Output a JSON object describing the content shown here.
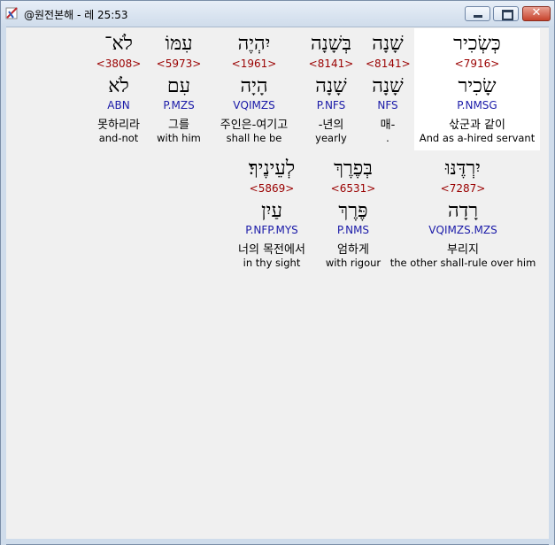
{
  "window": {
    "title": "@원전본해 - 레 25:53",
    "close_glyph": "✕"
  },
  "verse_rows": [
    [
      {
        "surface": "כְּשְׂכִיר",
        "strong": "<7916>",
        "lemma": "שָׂכִיר",
        "morph": "P.NMSG",
        "korean": "삯군과 같이",
        "english": "And as a-hired servant",
        "highlighted": true
      },
      {
        "surface": "שָׁנָה",
        "strong": "<8141>",
        "lemma": "שָׁנָה",
        "morph": "NFS",
        "korean": "매-",
        "english": "."
      },
      {
        "surface": "בְּשָׁנָה",
        "strong": "<8141>",
        "lemma": "שָׁנָה",
        "morph": "P.NFS",
        "korean": "-년의",
        "english": "yearly"
      },
      {
        "surface": "יִהְיֶה",
        "strong": "<1961>",
        "lemma": "הָיָה",
        "morph": "VQIMZS",
        "korean": "주인은-여기고",
        "english": "shall he be"
      },
      {
        "surface": "עִמּוֹ",
        "strong": "<5973>",
        "lemma": "עִם",
        "morph": "P.MZS",
        "korean": "그를",
        "english": "with him"
      },
      {
        "surface": "לֹא־",
        "strong": "<3808>",
        "lemma": "לֹא",
        "morph": "ABN",
        "korean": "못하리라",
        "english": "and-not"
      }
    ],
    [
      {
        "surface": "יִרְדֶּנּוּ",
        "strong": "<7287>",
        "lemma": "רָדָה",
        "morph": "VQIMZS.MZS",
        "korean": "부리지",
        "english": "the other shall-rule over him"
      },
      {
        "surface": "בְּפֶרֶךְ",
        "strong": "<6531>",
        "lemma": "פֶּרֶךְ",
        "morph": "P.NMS",
        "korean": "엄하게",
        "english": "with rigour"
      },
      {
        "surface": "לְעֵינֶיךָ׃",
        "strong": "<5869>",
        "lemma": "עַיִן",
        "morph": "P.NFP.MYS",
        "korean": "너의 목전에서",
        "english": "in thy sight"
      }
    ]
  ]
}
